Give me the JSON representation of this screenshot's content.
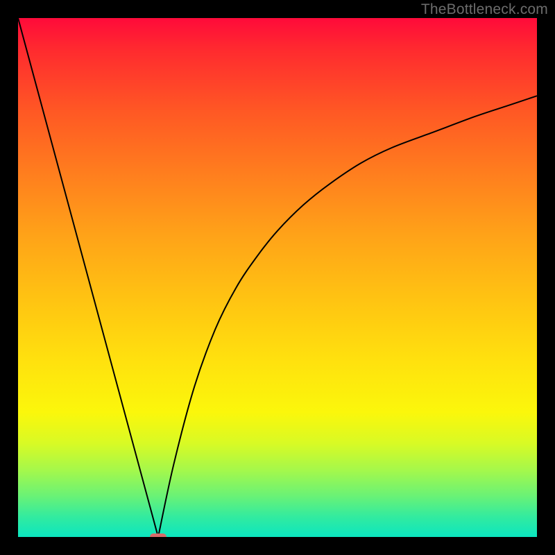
{
  "watermark": "TheBottleneck.com",
  "colors": {
    "frame": "#000000",
    "curve": "#000000",
    "marker": "#d86a6a"
  },
  "chart_data": {
    "type": "line",
    "title": "",
    "xlabel": "",
    "ylabel": "",
    "xlim": [
      0,
      100
    ],
    "ylim": [
      0,
      100
    ],
    "x_min_point": 27,
    "marker": {
      "x": 27,
      "y": 0
    },
    "left": {
      "comment": "linear descent from top-left down to the minimum",
      "x": [
        0,
        27
      ],
      "y": [
        100,
        0
      ]
    },
    "right": {
      "comment": "curved ascent from minimum toward upper-right, asymptotic",
      "x": [
        27,
        30,
        34,
        38,
        42,
        46,
        50,
        55,
        60,
        66,
        72,
        80,
        88,
        94,
        100
      ],
      "y": [
        0,
        14,
        29,
        40,
        48,
        54,
        59,
        64,
        68,
        72,
        75,
        78,
        81,
        83,
        85
      ]
    }
  }
}
